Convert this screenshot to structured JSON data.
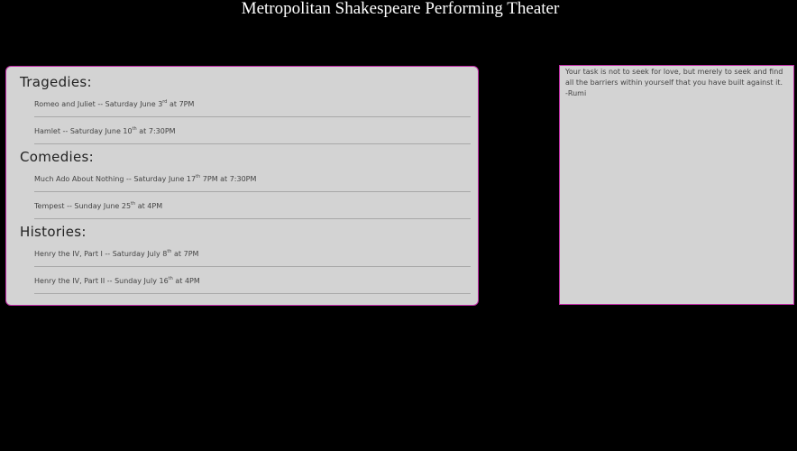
{
  "header": {
    "title": "Metropolitan Shakespeare Performing Theater"
  },
  "schedule": {
    "categories": [
      {
        "title": "Tragedies:",
        "shows": [
          {
            "text": "Romeo and Juliet -- Saturday June 3",
            "sup": "rd",
            "after": " at 7PM"
          },
          {
            "text": "Hamlet -- Saturday June 10",
            "sup": "th",
            "after": " at 7:30PM"
          }
        ]
      },
      {
        "title": "Comedies:",
        "shows": [
          {
            "text": "Much Ado About Nothing -- Saturday June 17",
            "sup": "th",
            "after": " 7PM at 7:30PM"
          },
          {
            "text": "Tempest -- Sunday June 25",
            "sup": "th",
            "after": " at 4PM"
          }
        ]
      },
      {
        "title": "Histories:",
        "shows": [
          {
            "text": "Henry the IV, Part I -- Saturday July 8",
            "sup": "th",
            "after": " at 7PM"
          },
          {
            "text": "Henry the IV, Part II -- Sunday July 16",
            "sup": "th",
            "after": " at 4PM"
          }
        ]
      }
    ]
  },
  "quote": {
    "text": "Your task is not to seek for love, but merely to seek and find all the barriers within yourself that you have built against it.",
    "author": "-Rumi"
  },
  "colors": {
    "background": "#000000",
    "panel": "#d3d3d3",
    "border_accent": "#c02aa6"
  }
}
